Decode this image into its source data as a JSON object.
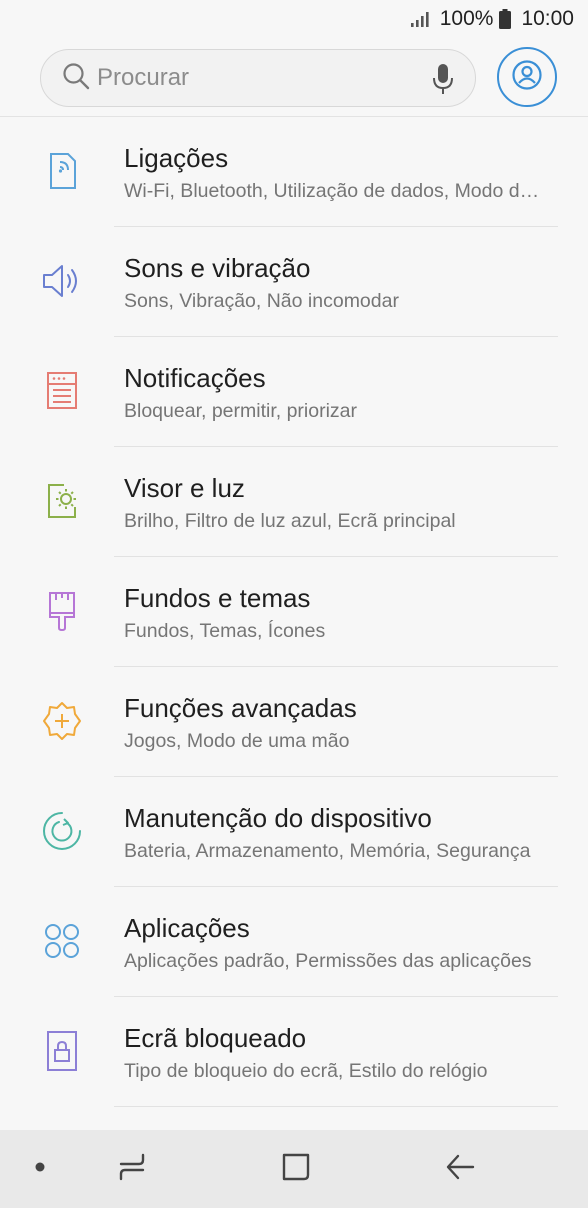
{
  "status_bar": {
    "battery": "100%",
    "time": "10:00"
  },
  "search": {
    "placeholder": "Procurar"
  },
  "settings": [
    {
      "icon": "connections-icon",
      "color": "#5ba3d9",
      "title": "Ligações",
      "subtitle": "Wi-Fi, Bluetooth, Utilização de dados, Modo de voo"
    },
    {
      "icon": "speaker-icon",
      "color": "#6a7fd0",
      "title": "Sons e vibração",
      "subtitle": "Sons, Vibração, Não incomodar"
    },
    {
      "icon": "notifications-icon",
      "color": "#e57c73",
      "title": "Notificações",
      "subtitle": "Bloquear, permitir, priorizar"
    },
    {
      "icon": "display-icon",
      "color": "#8cb04a",
      "title": "Visor e luz",
      "subtitle": "Brilho, Filtro de luz azul, Ecrã principal"
    },
    {
      "icon": "paintbrush-icon",
      "color": "#b676d6",
      "title": "Fundos e temas",
      "subtitle": "Fundos, Temas, Ícones"
    },
    {
      "icon": "advanced-features-icon",
      "color": "#f0a93a",
      "title": "Funções avançadas",
      "subtitle": "Jogos, Modo de uma mão"
    },
    {
      "icon": "device-maintenance-icon",
      "color": "#4db6a4",
      "title": "Manutenção do dispositivo",
      "subtitle": "Bateria, Armazenamento, Memória, Segurança"
    },
    {
      "icon": "apps-icon",
      "color": "#5ba3d9",
      "title": "Aplicações",
      "subtitle": "Aplicações padrão, Permissões das aplicações"
    },
    {
      "icon": "lock-screen-icon",
      "color": "#8c7fd6",
      "title": "Ecrã bloqueado",
      "subtitle": "Tipo de bloqueio do ecrã, Estilo do relógio"
    }
  ]
}
